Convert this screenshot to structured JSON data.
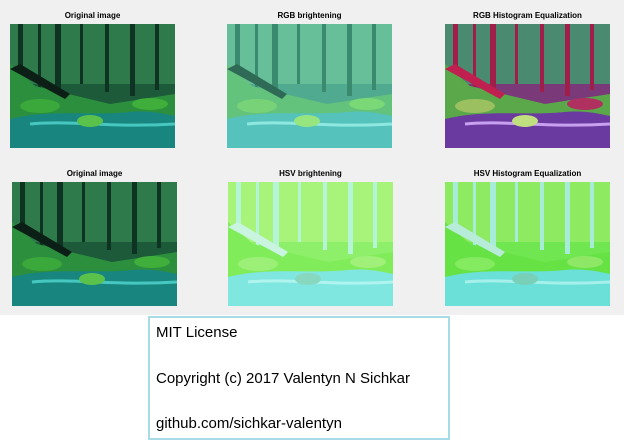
{
  "figure": {
    "panels": [
      {
        "title": "Original image",
        "variant": "original"
      },
      {
        "title": "RGB brightening",
        "variant": "rgb-bright"
      },
      {
        "title": "RGB Histogram Equalization",
        "variant": "rgb-histeq"
      },
      {
        "title": "Original image",
        "variant": "original"
      },
      {
        "title": "HSV brightening",
        "variant": "hsv-bright"
      },
      {
        "title": "HSV Histogram Equalization",
        "variant": "hsv-histeq"
      }
    ]
  },
  "license": {
    "line1": "MIT License",
    "line2": "Copyright (c) 2017 Valentyn N Sichkar",
    "line3": "github.com/sichkar-valentyn"
  },
  "colors": {
    "figure_background": "#f0f0f0",
    "license_border": "#a7dbe8"
  }
}
